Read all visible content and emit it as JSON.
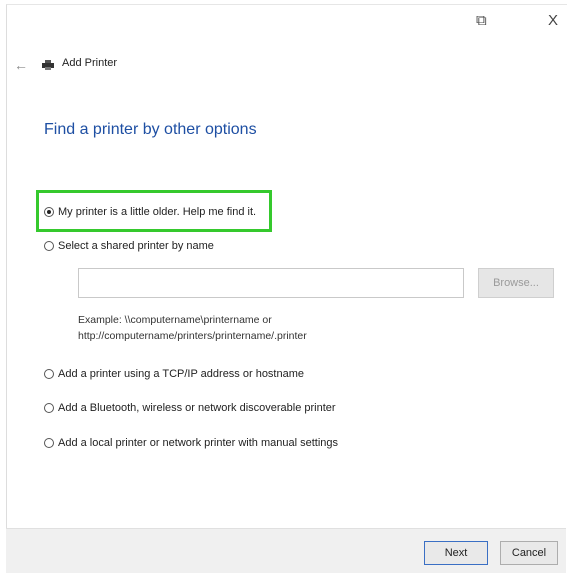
{
  "titlebar": {
    "restore_glyph": "⧉",
    "close_glyph": "X"
  },
  "header": {
    "back_glyph": "←",
    "title": "Add Printer",
    "icon": "printer-icon"
  },
  "main": {
    "heading": "Find a printer by other options",
    "options": [
      {
        "label": "My printer is a little older. Help me find it.",
        "selected": true
      },
      {
        "label": "Select a shared printer by name",
        "selected": false
      },
      {
        "label": "Add a printer using a TCP/IP address or hostname",
        "selected": false
      },
      {
        "label": "Add a Bluetooth, wireless or network discoverable printer",
        "selected": false
      },
      {
        "label": "Add a local printer or network printer with manual settings",
        "selected": false
      }
    ],
    "shared_name_input": {
      "value": "",
      "placeholder": ""
    },
    "browse_label": "Browse...",
    "example_line1": "Example: \\\\computername\\printername or",
    "example_line2": "http://computername/printers/printername/.printer"
  },
  "footer": {
    "next_label": "Next",
    "cancel_label": "Cancel"
  },
  "colors": {
    "heading": "#1e4fa3",
    "highlight": "#35c92d",
    "accent": "#3a6fc4"
  }
}
